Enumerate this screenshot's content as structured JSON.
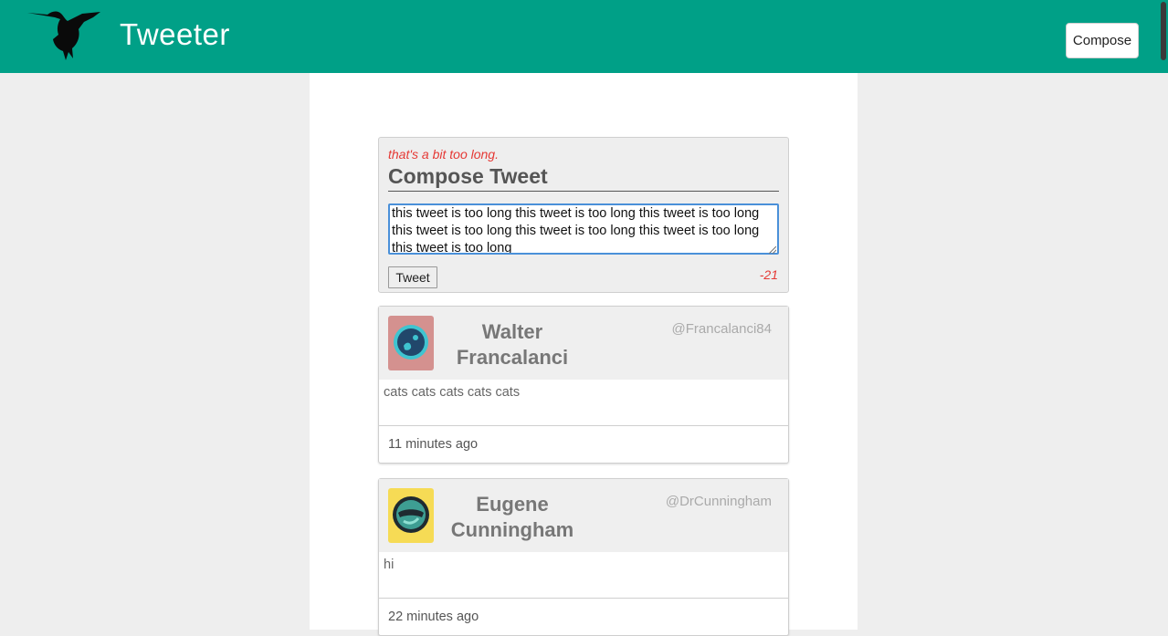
{
  "header": {
    "brand": "Tweeter",
    "compose_label": "Compose",
    "accent_color": "#00a087",
    "logo_icon": "hummingbird-logo-icon"
  },
  "composer": {
    "error": "that's a bit too long.",
    "title": "Compose Tweet",
    "text": "this tweet is too long this tweet is too long this tweet is too long this tweet is too long this tweet is too long this tweet is too long this tweet is too long ",
    "submit_label": "Tweet",
    "counter": "-21",
    "error_color": "#e53935"
  },
  "tweets": [
    {
      "name": "Walter Francalanci",
      "handle": "@Francalanci84",
      "content": "cats cats cats cats cats",
      "time": "11 minutes ago",
      "avatar_bg": "#d4918f",
      "avatar_icon": "robot-avatar-icon"
    },
    {
      "name": "Eugene Cunningham",
      "handle": "@DrCunningham",
      "content": "hi",
      "time": "22 minutes ago",
      "avatar_bg": "#f6db55",
      "avatar_icon": "robot-avatar-icon"
    }
  ]
}
